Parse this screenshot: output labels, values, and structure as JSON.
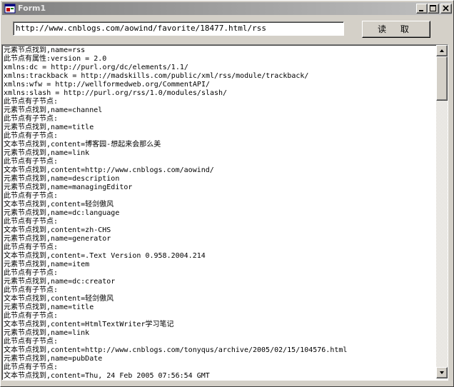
{
  "window": {
    "title": "Form1"
  },
  "url_input": {
    "value": "http://www.cnblogs.com/aowind/favorite/18477.html/rss"
  },
  "read_button": {
    "label": "读 取"
  },
  "output": {
    "lines": [
      "元素节点找到,name=rss",
      "此节点有属性:version = 2.0",
      "xmlns:dc = http://purl.org/dc/elements/1.1/",
      "xmlns:trackback = http://madskills.com/public/xml/rss/module/trackback/",
      "xmlns:wfw = http://wellformedweb.org/CommentAPI/",
      "xmlns:slash = http://purl.org/rss/1.0/modules/slash/",
      "此节点有子节点:",
      "元素节点找到,name=channel",
      "此节点有子节点:",
      "元素节点找到,name=title",
      "此节点有子节点:",
      "文本节点找到,content=博客园-想起来会那么美",
      "元素节点找到,name=link",
      "此节点有子节点:",
      "文本节点找到,content=http://www.cnblogs.com/aowind/",
      "元素节点找到,name=description",
      "元素节点找到,name=managingEditor",
      "此节点有子节点:",
      "文本节点找到,content=轻剑傲风",
      "元素节点找到,name=dc:language",
      "此节点有子节点:",
      "文本节点找到,content=zh-CHS",
      "元素节点找到,name=generator",
      "此节点有子节点:",
      "文本节点找到,content=.Text Version 0.958.2004.214",
      "元素节点找到,name=item",
      "此节点有子节点:",
      "元素节点找到,name=dc:creator",
      "此节点有子节点:",
      "文本节点找到,content=轻剑傲风",
      "元素节点找到,name=title",
      "此节点有子节点:",
      "文本节点找到,content=HtmlTextWriter学习笔记",
      "元素节点找到,name=link",
      "此节点有子节点:",
      "文本节点找到,content=http://www.cnblogs.com/tonyqus/archive/2005/02/15/104576.html",
      "元素节点找到,name=pubDate",
      "此节点有子节点:",
      "文本节点找到,content=Thu, 24 Feb 2005 07:56:54 GMT"
    ]
  },
  "icons": {
    "app": "form-app-icon",
    "minimize": "minimize-icon",
    "maximize": "maximize-icon",
    "close": "close-icon",
    "scroll_up": "arrow-up-icon",
    "scroll_down": "arrow-down-icon"
  }
}
